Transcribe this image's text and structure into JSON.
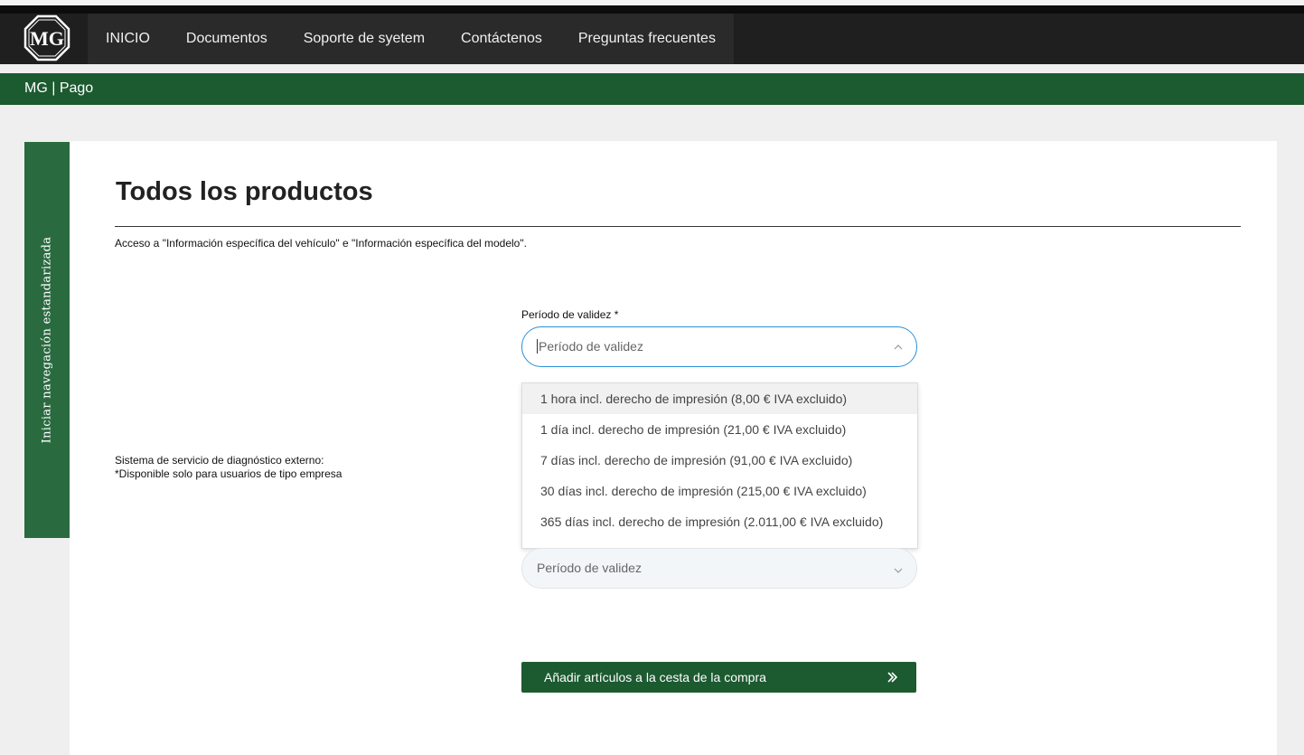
{
  "nav": {
    "logo_text": "MG",
    "items": [
      "INICIO",
      "Documentos",
      "Soporte de syetem",
      "Contáctenos",
      "Preguntas frecuentes"
    ]
  },
  "breadcrumb": "MG | Pago",
  "sidebar": {
    "tab_label": "Iniciar navegación estandarizada"
  },
  "main": {
    "title": "Todos los productos",
    "description": "Acceso a \"Información específica del vehículo\" e \"Información específica del modelo\".",
    "validity_field": {
      "label": "Período de validez *",
      "placeholder": "Período de validez",
      "options": [
        "1 hora incl. derecho de impresión (8,00 € IVA excluido)",
        "1 día incl. derecho de impresión (21,00 € IVA excluido)",
        "7 días incl. derecho de impresión (91,00 € IVA excluido)",
        "30 días incl. derecho de impresión (215,00 € IVA excluido)",
        "365 días incl. derecho de impresión (2.011,00 € IVA excluido)"
      ]
    },
    "external_system": {
      "label_line1": "Sistema de servicio de diagnóstico externo:",
      "label_line2": "*Disponible solo para usuarios de tipo empresa",
      "placeholder": "Período de validez"
    },
    "add_button_label": "Añadir artículos a la cesta de la compra"
  },
  "colors": {
    "brand_green": "#1c5a30",
    "sidebar_green": "#2a6a3f",
    "focus_blue": "#2a8fd8",
    "nav_dark": "#1f1f1f"
  },
  "icons": {
    "logo": "mg-logo-icon",
    "open_caret": "chevron-up-icon",
    "closed_caret": "chevron-down-icon",
    "button_icon": "double-chevron-right-icon"
  }
}
